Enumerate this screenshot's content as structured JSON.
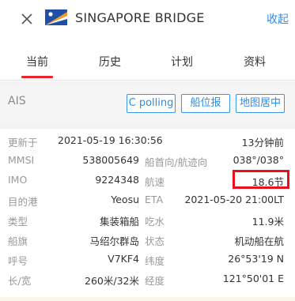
{
  "header": {
    "ship_name": "SINGAPORE BRIDGE",
    "collapse_label": "收起"
  },
  "tabs": [
    {
      "label": "当前",
      "active": true
    },
    {
      "label": "历史",
      "active": false
    },
    {
      "label": "计划",
      "active": false
    },
    {
      "label": "资料",
      "active": false
    }
  ],
  "ais": {
    "title": "AIS",
    "buttons": [
      "C polling",
      "船位报",
      "地图居中"
    ]
  },
  "details": {
    "updated_label": "更新于",
    "updated_value": "2021-05-19 16:30:56",
    "updated_ago": "13分钟前",
    "mmsi_label": "MMSI",
    "mmsi_value": "538005649",
    "heading_label": "船首向/航迹向",
    "heading_value": "038°/038°",
    "imo_label": "IMO",
    "imo_value": "9224348",
    "speed_label": "航速",
    "speed_value": "18.6节",
    "dest_label": "目的港",
    "dest_value": "Yeosu",
    "eta_label": "ETA",
    "eta_value": "2021-05-20 21:00LT",
    "type_label": "类型",
    "type_value": "集装箱船",
    "draft_label": "吃水",
    "draft_value": "11.9米",
    "flag_label": "船旗",
    "flag_value": "马绍尔群岛",
    "status_label": "状态",
    "status_value": "机动船在航",
    "callsign_label": "呼号",
    "callsign_value": "V7KF4",
    "lat_label": "纬度",
    "lat_value": "26°53'19 N",
    "size_label": "长/宽",
    "size_value": "260米/32米",
    "lon_label": "经度",
    "lon_value": "121°50'01 E"
  },
  "colors": {
    "accent": "#2f8ce3",
    "tab_underline": "#e8242c",
    "highlight_box": "#e8101a"
  }
}
